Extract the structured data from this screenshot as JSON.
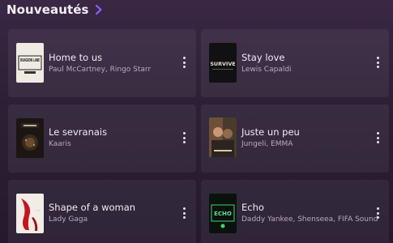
{
  "section": {
    "title": "Nouveautés",
    "chevron_icon": "chevron-right-icon",
    "accent": "#8a5cf6"
  },
  "tracks": [
    {
      "title": "Home to us",
      "artist": "Paul McCartney, Ringo Starr",
      "cover_text": "DUNGEON LANE"
    },
    {
      "title": "Stay love",
      "artist": "Lewis Capaldi",
      "cover_text": "SURVIVE"
    },
    {
      "title": "Le sevranais",
      "artist": "Kaaris"
    },
    {
      "title": "Juste un peu",
      "artist": "Jungeli, EMMA"
    },
    {
      "title": "Shape of a woman",
      "artist": "Lady Gaga"
    },
    {
      "title": "Echo",
      "artist": "Daddy Yankee, Shenseea, FIFA Sound",
      "cover_text": "ECHO"
    }
  ]
}
